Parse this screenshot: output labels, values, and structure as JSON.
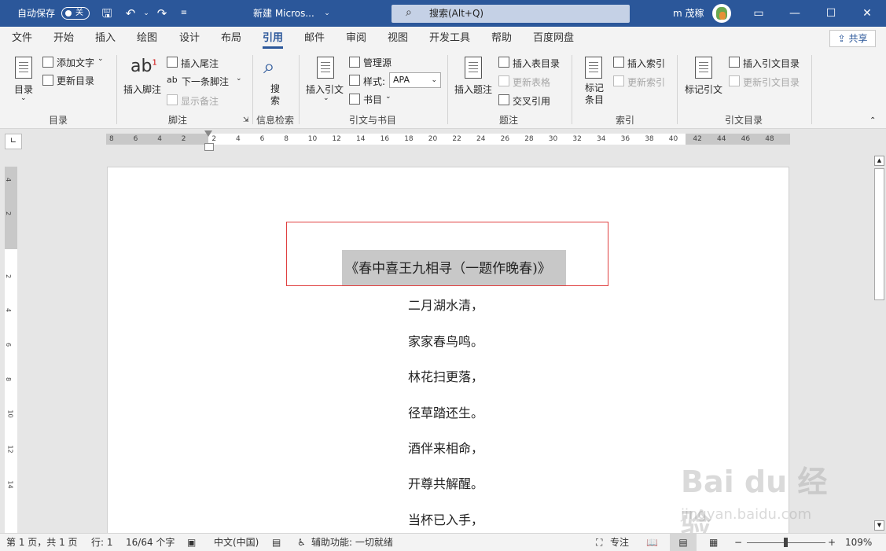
{
  "titlebar": {
    "autosave_label": "自动保存",
    "autosave_state": "关",
    "doc_title": "新建 Micros...",
    "search_placeholder": "搜索(Alt+Q)",
    "user_name": "m 茂稼",
    "accent_color": "#2b579a"
  },
  "tabs": [
    "文件",
    "开始",
    "插入",
    "绘图",
    "设计",
    "布局",
    "引用",
    "邮件",
    "审阅",
    "视图",
    "开发工具",
    "帮助",
    "百度网盘"
  ],
  "active_tab": "引用",
  "share_label": "共享",
  "ribbon": {
    "toc": {
      "big": "目录",
      "add_text": "添加文字",
      "update": "更新目录",
      "group": "目录"
    },
    "footnote": {
      "insert": "插入脚注",
      "endnote": "插入尾注",
      "next": "下一条脚注",
      "show": "显示备注",
      "group": "脚注"
    },
    "research": {
      "search": "搜\n索",
      "group": "信息检索"
    },
    "citations": {
      "insert": "插入引文",
      "manage": "管理源",
      "style_label": "样式:",
      "style_value": "APA",
      "biblio": "书目",
      "group": "引文与书目"
    },
    "captions": {
      "insert": "插入题注",
      "table_fig": "插入表目录",
      "update_table": "更新表格",
      "cross": "交叉引用",
      "group": "题注"
    },
    "index": {
      "mark": "标记\n条目",
      "insert": "插入索引",
      "update": "更新索引",
      "group": "索引"
    },
    "toa": {
      "mark": "标记引文",
      "insert": "插入引文目录",
      "update": "更新引文目录",
      "group": "引文目录"
    }
  },
  "ruler_ticks": [
    "8",
    "6",
    "4",
    "2",
    "2",
    "4",
    "6",
    "8",
    "10",
    "12",
    "14",
    "16",
    "18",
    "20",
    "22",
    "24",
    "26",
    "28",
    "30",
    "32",
    "34",
    "36",
    "38",
    "40",
    "42",
    "44",
    "46",
    "48"
  ],
  "vruler_ticks": [
    "4",
    "2",
    "2",
    "4",
    "6",
    "8",
    "10",
    "12",
    "14"
  ],
  "document": {
    "title": "《春中喜王九相寻（一题作晚春)》",
    "lines": [
      "二月湖水清，",
      "家家春鸟鸣。",
      "林花扫更落，",
      "径草踏还生。",
      "酒伴来相命，",
      "开尊共解醒。",
      "当杯已入手，"
    ]
  },
  "statusbar": {
    "page": "第 1 页，共 1 页",
    "line": "行: 1",
    "words": "16/64 个字",
    "lang": "中文(中国)",
    "accessibility": "辅助功能: 一切就绪",
    "focus": "专注",
    "zoom": "109%"
  },
  "watermark": {
    "logo": "Bai du 经验",
    "url": "jingyan.baidu.com"
  }
}
